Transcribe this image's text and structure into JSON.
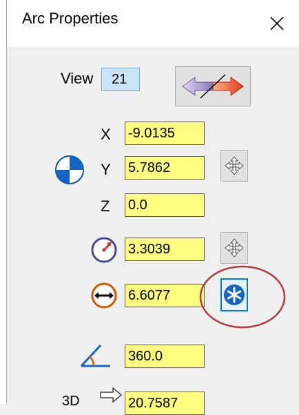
{
  "window": {
    "title": "Arc Properties"
  },
  "view": {
    "label": "View",
    "value": "21"
  },
  "coords": {
    "x_label": "X",
    "x_value": "-9.0135",
    "y_label": "Y",
    "y_value": "5.7862",
    "z_label": "Z",
    "z_value": "0.0"
  },
  "radius": {
    "value": "3.3039"
  },
  "diameter": {
    "value": "6.6077"
  },
  "angle": {
    "value": "360.0"
  },
  "length3d": {
    "label": "3D",
    "value": "20.7587"
  },
  "colors": {
    "field_bg": "#ffff80",
    "view_bg": "#cce4f7",
    "annotation_red": "#c0392b"
  }
}
